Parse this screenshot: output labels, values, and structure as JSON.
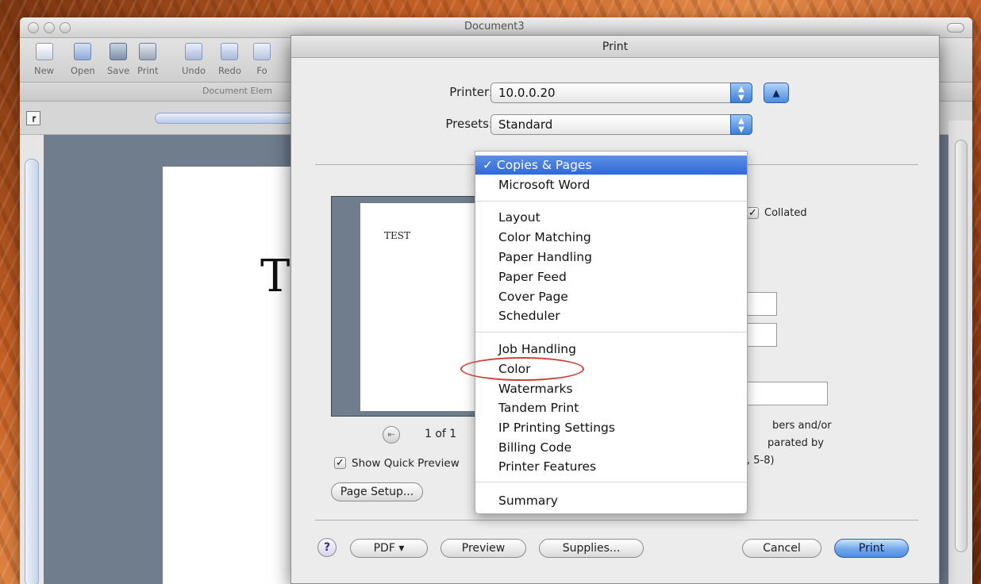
{
  "word": {
    "doc_title": "Document3",
    "toolbar": [
      "New",
      "Open",
      "Save",
      "Print",
      "Undo",
      "Redo",
      "Fo"
    ],
    "ribbon_label": "Document Elem",
    "page_text": "T"
  },
  "print_dialog": {
    "title": "Print",
    "printer_label": "Printer:",
    "printer_value": "10.0.0.20",
    "presets_label": "Presets:",
    "presets_value": "Standard",
    "preview_text": "TEST",
    "page_count": "1 of 1",
    "show_quick_preview": "Show Quick Preview",
    "page_setup": "Page Setup...",
    "collated": "Collated",
    "pages_hint": [
      "bers and/or",
      "parated by",
      ", 5-8)"
    ],
    "buttons": {
      "help": "?",
      "pdf": "PDF ▾",
      "preview": "Preview",
      "supplies": "Supplies...",
      "cancel": "Cancel",
      "print": "Print"
    }
  },
  "menu": {
    "selected": "✓ Copies & Pages",
    "items": [
      "Microsoft Word",
      "Layout",
      "Color Matching",
      "Paper Handling",
      "Paper Feed",
      "Cover Page",
      "Scheduler",
      "Job Handling",
      "Color",
      "Watermarks",
      "Tandem Print",
      "IP Printing Settings",
      "Billing Code",
      "Printer Features",
      "Summary"
    ]
  },
  "colors": {
    "accent": "#2f6ad8",
    "annotation": "#c8443a"
  }
}
